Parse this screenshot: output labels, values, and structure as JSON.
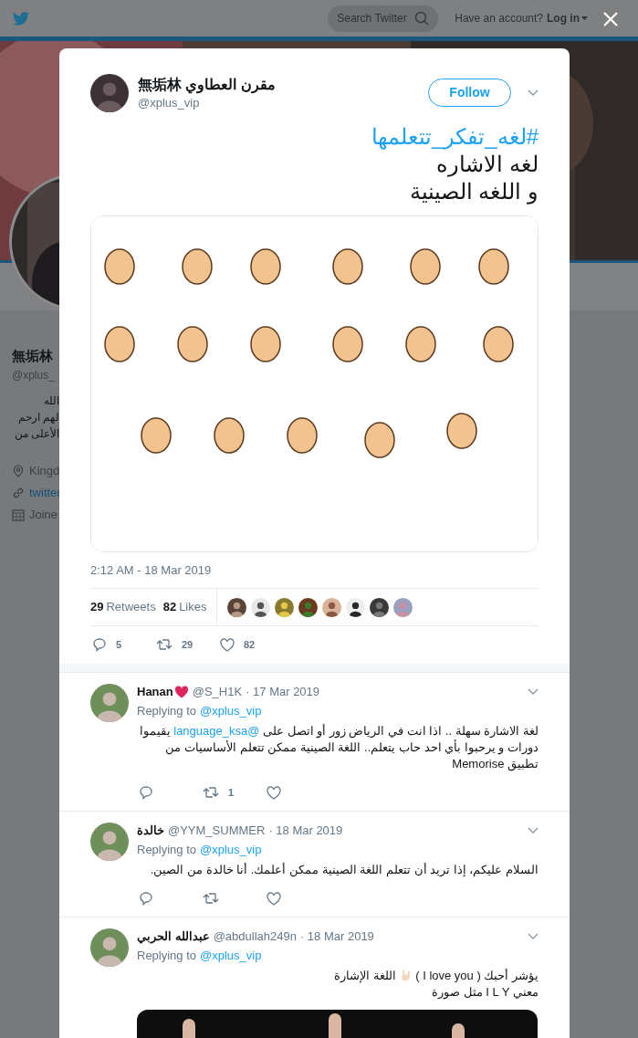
{
  "background_page": {
    "nav": {
      "search": {
        "placeholder": "Search Twitter"
      },
      "account_prompt": "Have an account?",
      "login": "Log in"
    },
    "profile": {
      "name": "無垢林",
      "handle": "@xplus_",
      "bio_lines": [
        "الله",
        "لهم ارحم",
        "الأعلى من"
      ],
      "location": "Kingd",
      "link": "twitter",
      "joined": "Joine"
    }
  },
  "tweet": {
    "author": {
      "name": "無垢林 مقرن العطاوي",
      "handle": "@xplus_vip"
    },
    "follow_button": "Follow",
    "text": {
      "hashtag": "#لغه_تفكر_تتعلمها",
      "lines": [
        "لغه الاشاره",
        "و اللغه الصينية"
      ]
    },
    "media": {
      "kind": "picture"
    },
    "timestamp": "2:12 AM - 18 Mar 2019",
    "stats": {
      "retweets": {
        "value": "29",
        "label": "Retweets"
      },
      "likes": {
        "value": "82",
        "label": "Likes"
      }
    },
    "liked_by": [
      {
        "kind": "picture"
      },
      {
        "kind": "picture"
      },
      {
        "kind": "picture"
      },
      {
        "kind": "picture"
      },
      {
        "kind": "picture"
      },
      {
        "kind": "picture"
      },
      {
        "kind": "picture"
      },
      {
        "kind": "picture"
      }
    ],
    "actions": {
      "replies": "5",
      "retweets": "29",
      "likes": "82"
    }
  },
  "replies": [
    {
      "name": "Hanan",
      "heart": true,
      "handle": "@S_H1K",
      "date": "· 17 Mar 2019",
      "replying_label": "Replying to",
      "replying_to": "@xplus_vip",
      "lines": [
        [
          {
            "kind": "text",
            "text": "لغة الاشارة سهلة .. اذا انت في الرياض زور أو اتصل على "
          },
          {
            "kind": "mention",
            "text": "@language_ksa"
          },
          {
            "kind": "text",
            "text": " يقيموا دورات و يرحبوا بأي احد حاب يتعلم.. اللغة الصينية ممكن تتعلم الأساسيات من تطبيق Memorise"
          }
        ]
      ],
      "actions": {
        "retweets": "1"
      }
    },
    {
      "name": "خالدة",
      "heart": false,
      "handle": "@YYM_SUMMER",
      "date": "· 18 Mar 2019",
      "replying_label": "Replying to",
      "replying_to": "@xplus_vip",
      "lines": [
        [
          {
            "kind": "text",
            "text": "السلام عليكم، إذا تريد أن تتعلم اللغة الصينية ممكن أعلمك. أنا خالدة من الصين."
          }
        ]
      ]
    },
    {
      "name": "عبدالله الحربي",
      "heart": false,
      "handle": "@abdullah249n",
      "date": "· 18 Mar 2019",
      "replying_label": "Replying to",
      "replying_to": "@xplus_vip",
      "lines": [
        [
          {
            "kind": "text",
            "text": "يؤشر أحبك ( I love you ) "
          },
          {
            "kind": "hand"
          },
          {
            "kind": "text",
            "text": " اللغة الإشارة"
          }
        ],
        [
          {
            "kind": "text",
            "text": "معني I L Y مثل صورة"
          }
        ]
      ],
      "media": {
        "kind": "picture"
      }
    }
  ]
}
